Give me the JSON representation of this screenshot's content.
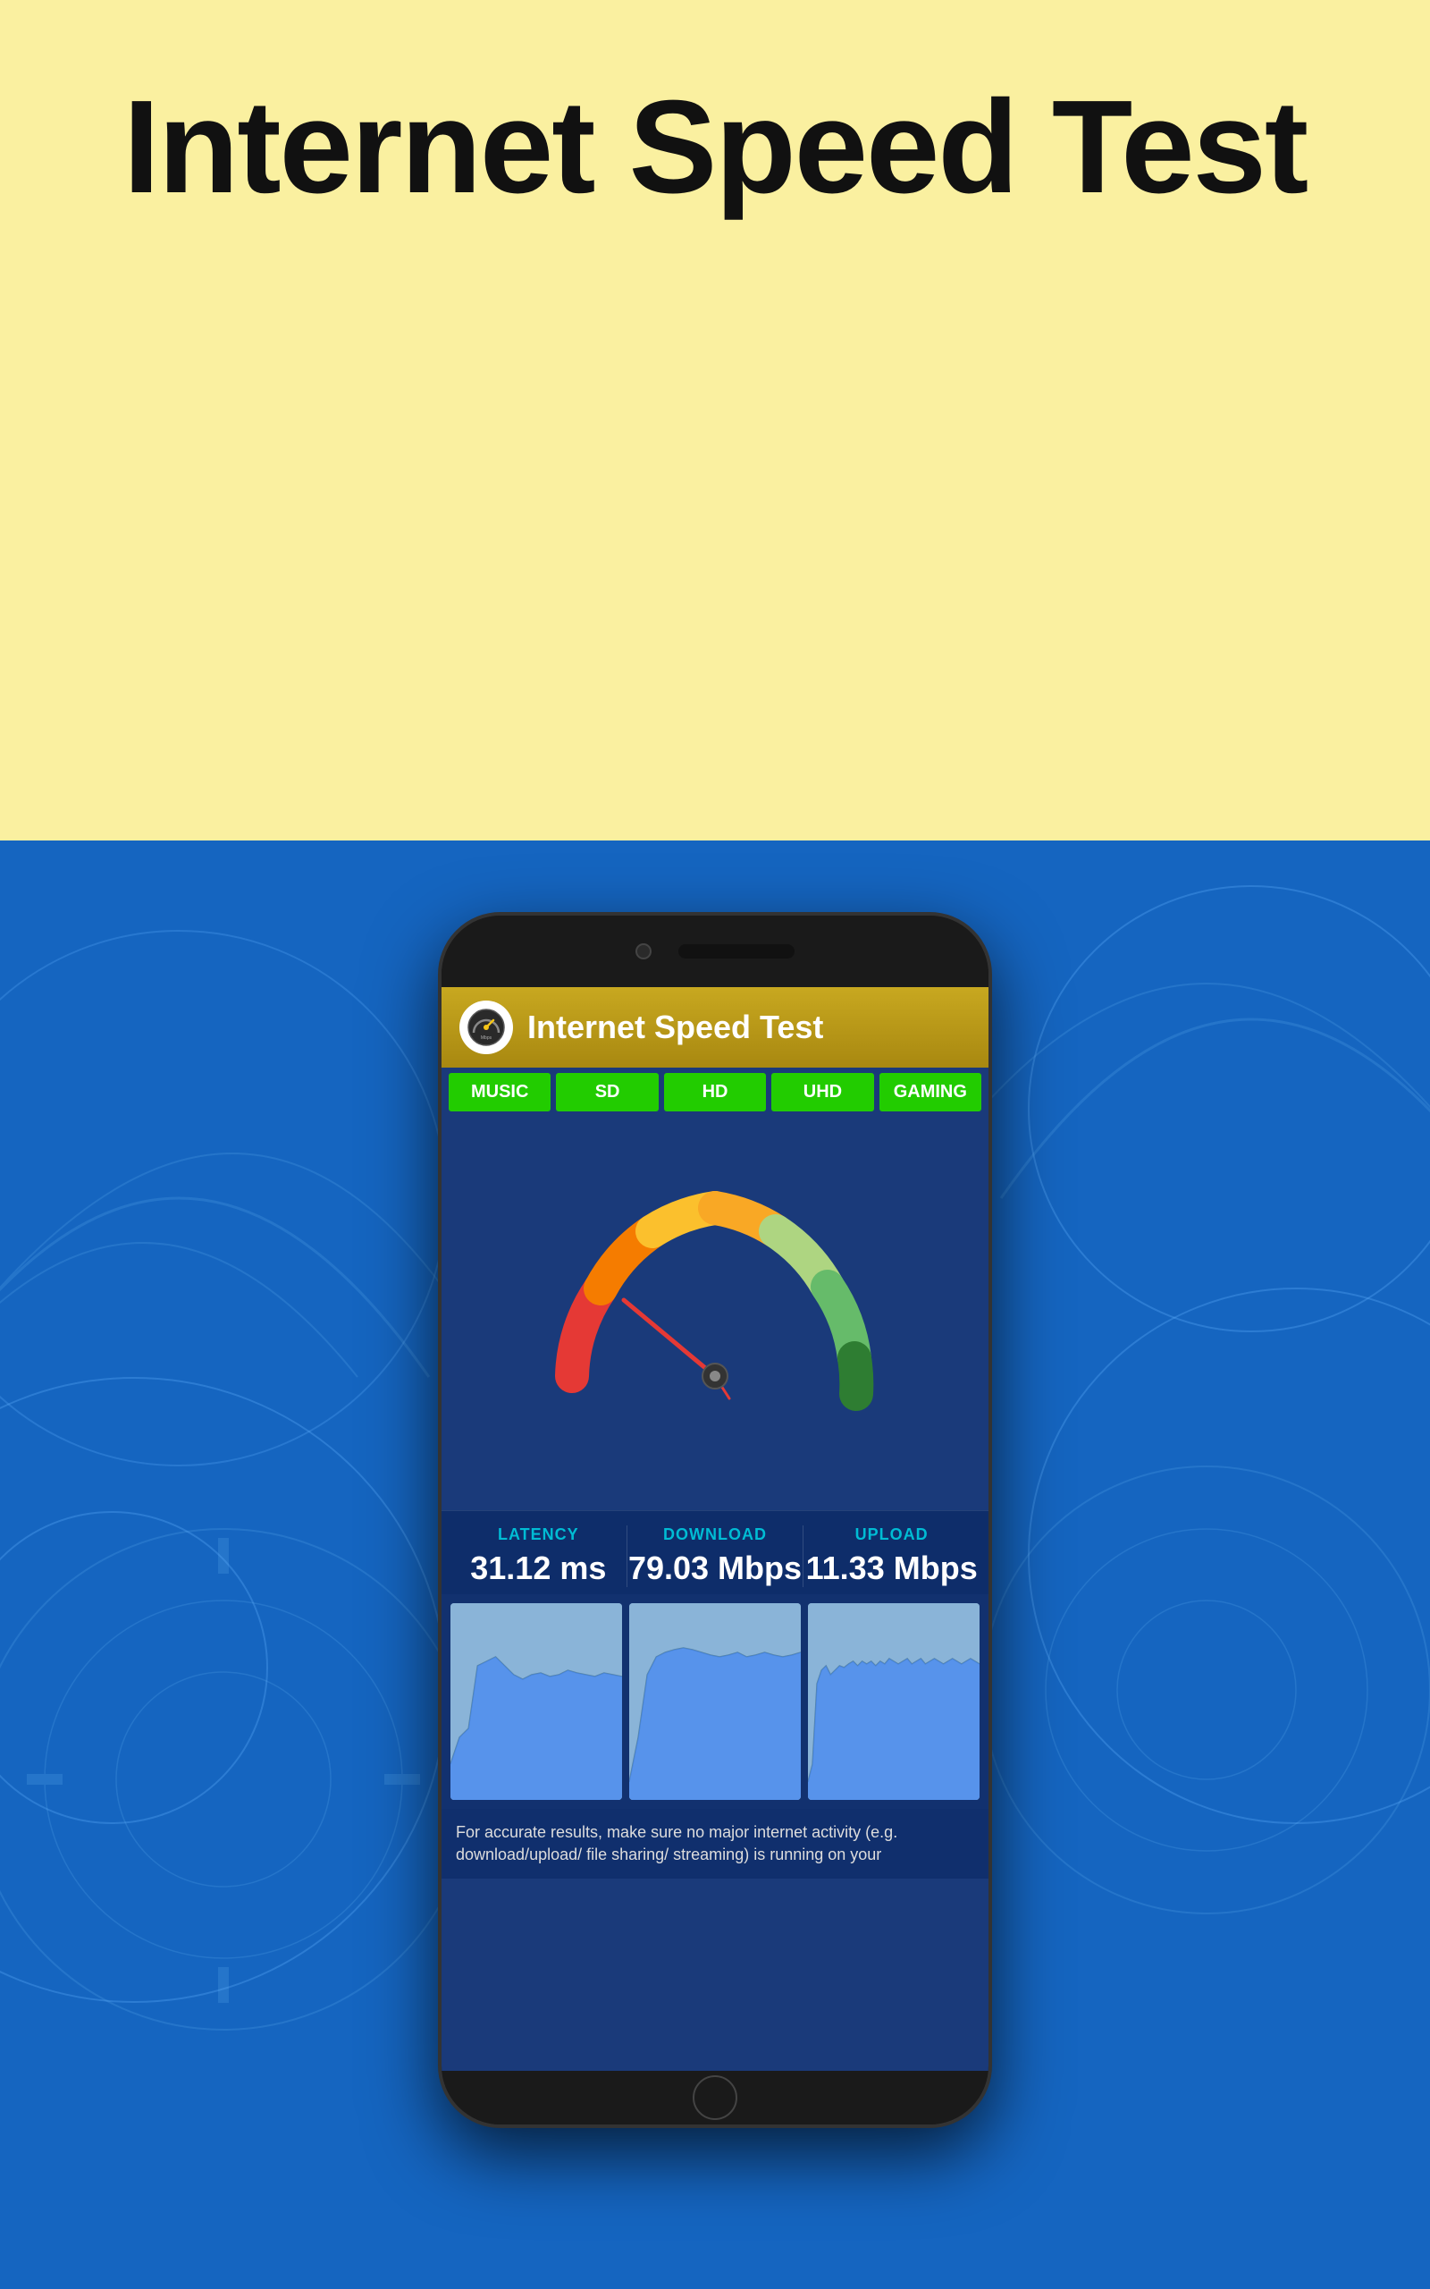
{
  "page": {
    "title": "Internet Speed Test",
    "background_top": "#FAF0A0",
    "background_bottom": "#1565C0"
  },
  "app": {
    "header_title": "Internet Speed Test",
    "header_icon": "🏎️"
  },
  "tabs": [
    {
      "label": "MUSIC"
    },
    {
      "label": "SD"
    },
    {
      "label": "HD"
    },
    {
      "label": "UHD"
    },
    {
      "label": "GAMING"
    }
  ],
  "stats": {
    "latency_label": "LATENCY",
    "latency_value": "31.12 ms",
    "download_label": "DOWNLOAD",
    "download_value": "79.03 Mbps",
    "upload_label": "UPLOAD",
    "upload_value": "11.33 Mbps"
  },
  "footer_text": "For accurate results, make sure no major internet activity (e.g. download/upload/ file sharing/ streaming) is running on your"
}
